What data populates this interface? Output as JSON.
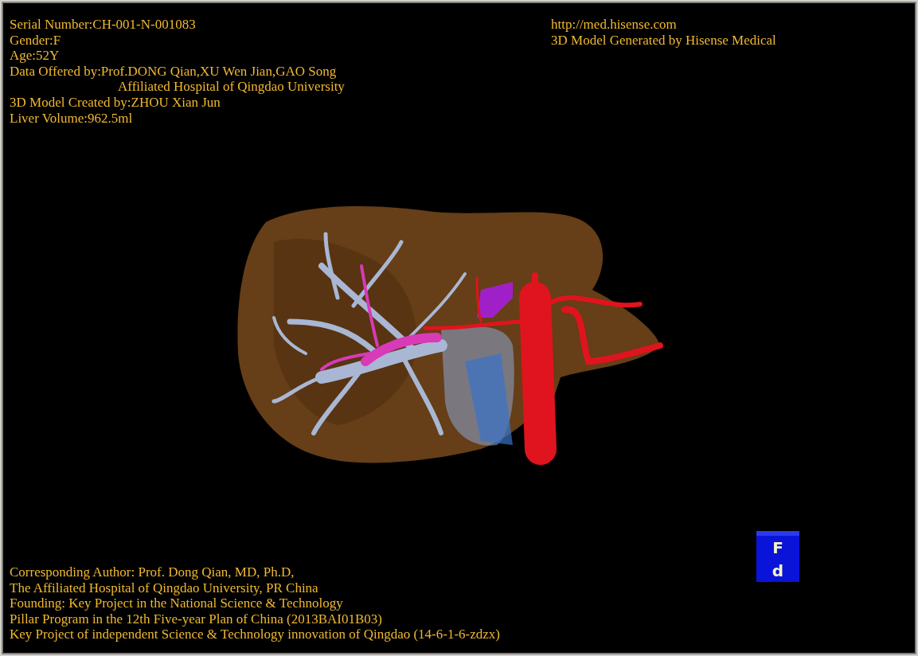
{
  "info_left": [
    {
      "text": "Serial Number:CH-001-N-001083",
      "indented": false
    },
    {
      "text": "Gender:F",
      "indented": false
    },
    {
      "text": "Age:52Y",
      "indented": false
    },
    {
      "text": "Data Offered by:Prof.DONG Qian,XU Wen Jian,GAO Song",
      "indented": false
    },
    {
      "text": "Affiliated Hospital of Qingdao University",
      "indented": true
    },
    {
      "text": "3D Model Created by:ZHOU Xian Jun",
      "indented": false
    },
    {
      "text": "Liver Volume:962.5ml",
      "indented": false
    }
  ],
  "info_right": [
    "http://med.hisense.com",
    "3D Model Generated by Hisense Medical"
  ],
  "footer": [
    "Corresponding Author: Prof. Dong Qian, MD, Ph.D,",
    "The Affiliated Hospital of Qingdao University, PR China",
    "Founding: Key Project in the National Science & Technology",
    "Pillar Program in the 12th Five-year Plan of China (2013BAI01B03)",
    "Key Project of independent Science & Technology innovation of Qingdao (14-6-1-6-zdzx)"
  ],
  "orientation_cube": {
    "top_label": "F",
    "front_label": "d"
  }
}
